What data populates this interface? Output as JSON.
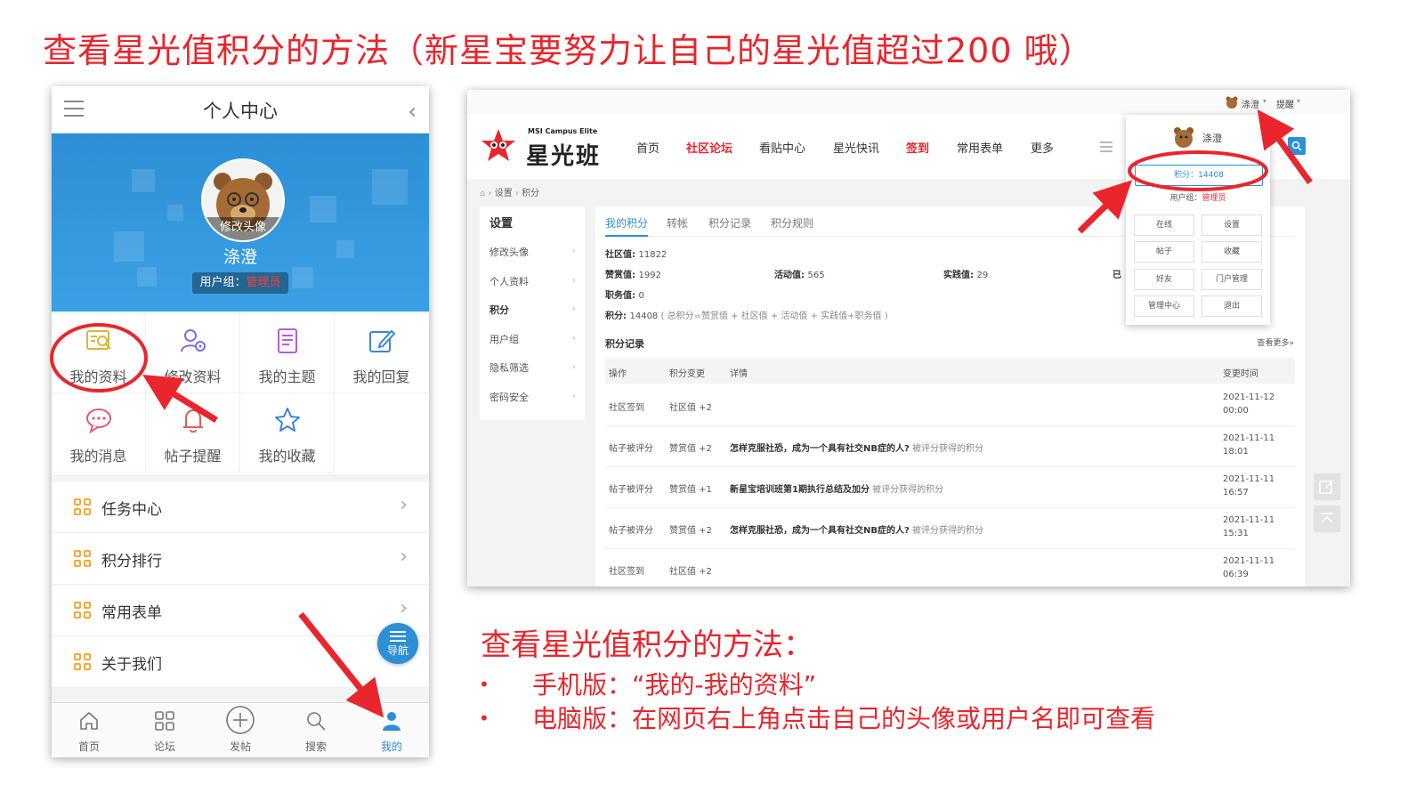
{
  "slide_title": "查看星光值积分的方法（新星宝要努力让自己的星光值超过200 哦）",
  "mobile": {
    "title": "个人中心",
    "avatar_caption": "修改头像",
    "username": "涤澄",
    "group_label": "用户组：",
    "group_value": "管理员",
    "grid": [
      {
        "label": "我的资料",
        "icon": "profile-card-icon"
      },
      {
        "label": "修改资料",
        "icon": "user-settings-icon"
      },
      {
        "label": "我的主题",
        "icon": "document-icon"
      },
      {
        "label": "我的回复",
        "icon": "edit-icon"
      },
      {
        "label": "我的消息",
        "icon": "chat-bubble-icon"
      },
      {
        "label": "帖子提醒",
        "icon": "bell-icon"
      },
      {
        "label": "我的收藏",
        "icon": "star-icon"
      }
    ],
    "menu": [
      {
        "label": "任务中心"
      },
      {
        "label": "积分排行"
      },
      {
        "label": "常用表单"
      },
      {
        "label": "关于我们"
      }
    ],
    "fab_label": "导航",
    "tabs": [
      {
        "label": "首页"
      },
      {
        "label": "论坛"
      },
      {
        "label": "发帖"
      },
      {
        "label": "搜索"
      },
      {
        "label": "我的"
      }
    ],
    "accent": "#2d8fd6"
  },
  "web": {
    "top_user": "涤澄",
    "top_remind": "提醒",
    "logo_sub": "MSI Campus Elite",
    "logo_main": "星光班",
    "nav": [
      "首页",
      "社区论坛",
      "看贴中心",
      "星光快讯",
      "签到",
      "常用表单",
      "更多"
    ],
    "breadcrumb": [
      "设置",
      "积分"
    ],
    "sidebar_title": "设置",
    "sidebar": [
      "修改头像",
      "个人资料",
      "积分",
      "用户组",
      "隐私筛选",
      "密码安全"
    ],
    "tabs": [
      "我的积分",
      "转帐",
      "积分记录",
      "积分规则"
    ],
    "stats": {
      "community": "社区值: ",
      "community_v": "11822",
      "praise": "赞赏值: ",
      "praise_v": "1992",
      "activity": "活动值: ",
      "activity_v": "565",
      "practice": "实践值: ",
      "practice_v": "29",
      "cut": "已",
      "duty": "职务值: ",
      "duty_v": "0",
      "points": "积分: ",
      "points_v": "14408",
      "points_note": "( 总积分=赞赏值 + 社区值 + 活动值 + 实践值+职务值 )"
    },
    "records_title": "积分记录",
    "records_more": "查看更多»",
    "columns": [
      "操作",
      "积分变更",
      "详情",
      "变更时间"
    ],
    "records": [
      {
        "op": "社区签到",
        "change": "社区值 +2",
        "detail": "",
        "suffix": "",
        "date": "2021-11-12",
        "time": "00:00"
      },
      {
        "op": "帖子被评分",
        "change": "赞赏值 +2",
        "detail": "怎样克服社恐，成为一个具有社交NB症的人?",
        "suffix": "被评分获得的积分",
        "date": "2021-11-11",
        "time": "18:01"
      },
      {
        "op": "帖子被评分",
        "change": "赞赏值 +1",
        "detail": "新星宝培训班第1期执行总结及加分",
        "suffix": "被评分获得的积分",
        "date": "2021-11-11",
        "time": "16:57"
      },
      {
        "op": "帖子被评分",
        "change": "赞赏值 +2",
        "detail": "怎样克服社恐，成为一个具有社交NB症的人?",
        "suffix": "被评分获得的积分",
        "date": "2021-11-11",
        "time": "15:31"
      },
      {
        "op": "社区签到",
        "change": "社区值 +2",
        "detail": "",
        "suffix": "",
        "date": "2021-11-11",
        "time": "06:39"
      }
    ],
    "dropdown": {
      "name": "涤澄",
      "score": "积分：14408",
      "group_label": "用户组：",
      "group_value": "管理员",
      "buttons": [
        "在线",
        "设置",
        "帖子",
        "收藏",
        "好友",
        "门户管理",
        "管理中心",
        "退出"
      ]
    }
  },
  "notes": {
    "title": "查看星光值积分的方法：",
    "bullets": [
      "手机版：“我的-我的资料”",
      "电脑版：在网页右上角点击自己的头像或用户名即可查看"
    ],
    "color": "#e8262c"
  }
}
